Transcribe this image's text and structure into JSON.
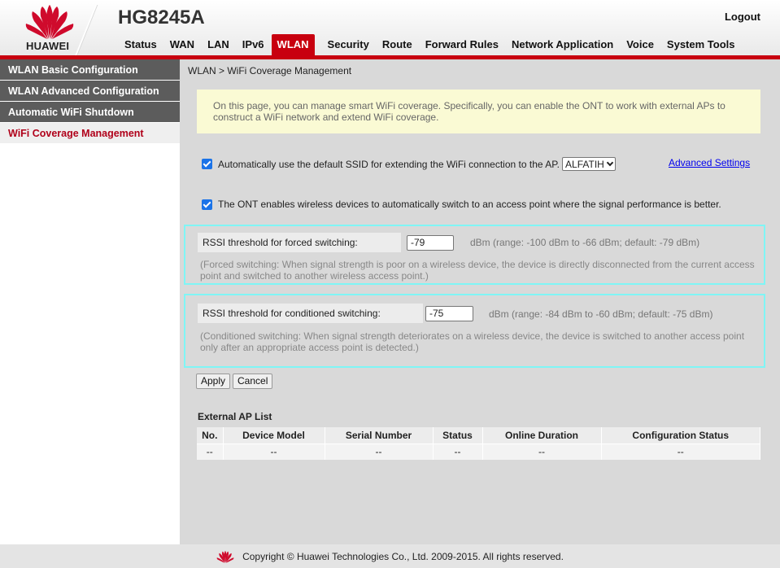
{
  "header": {
    "brand": "HUAWEI",
    "model": "HG8245A",
    "logout_label": "Logout",
    "accent_color": "#c8000f"
  },
  "nav": {
    "items": [
      "Status",
      "WAN",
      "LAN",
      "IPv6",
      "WLAN",
      "Security",
      "Route",
      "Forward Rules",
      "Network Application",
      "Voice",
      "System Tools"
    ],
    "active": "WLAN"
  },
  "sidebar": {
    "items": [
      {
        "label": "WLAN Basic Configuration"
      },
      {
        "label": "WLAN Advanced Configuration"
      },
      {
        "label": "Automatic WiFi Shutdown"
      },
      {
        "label": "WiFi Coverage Management"
      }
    ],
    "active": "WiFi Coverage Management"
  },
  "main": {
    "breadcrumb": "WLAN > WiFi Coverage Management",
    "info_line1": "On this page, you can manage smart WiFi coverage. Specifically, you can enable the ONT to work with external APs to",
    "info_line2": "construct a WiFi network and extend WiFi coverage.",
    "auto_ssid_label": "Automatically use the default SSID for extending the WiFi connection to the AP.",
    "auto_ssid_checked": true,
    "ssid_selected": "ALFATIH",
    "advanced_settings_label": "Advanced Settings",
    "auto_switch_label": "The ONT enables wireless devices to automatically switch to an access point where the signal performance is better.",
    "auto_switch_checked": true,
    "forced": {
      "label": "RSSI threshold for forced switching:",
      "value": "-79",
      "hint": "dBm (range: -100 dBm to -66 dBm; default: -79 dBm)",
      "note_line1": "(Forced switching: When signal strength is poor on a wireless device, the device is directly disconnected from the current access",
      "note_line2": "point and switched to another wireless access point.)"
    },
    "conditioned": {
      "label": "RSSI threshold for conditioned switching:",
      "value": "-75",
      "hint": "dBm (range: -84 dBm to -60 dBm; default: -75 dBm)",
      "note_line1": "(Conditioned switching: When signal strength deteriorates on a wireless device, the device is switched to another access point",
      "note_line2": "only after an appropriate access point is detected.)"
    },
    "apply_label": "Apply",
    "cancel_label": "Cancel",
    "ap_list": {
      "title": "External AP List",
      "columns": [
        "No.",
        "Device Model",
        "Serial Number",
        "Status",
        "Online Duration",
        "Configuration Status"
      ],
      "rows": [
        [
          "--",
          "--",
          "--",
          "--",
          "--",
          "--"
        ]
      ]
    }
  },
  "footer": {
    "copyright": "Copyright © Huawei Technologies Co., Ltd. 2009-2015. All rights reserved."
  }
}
